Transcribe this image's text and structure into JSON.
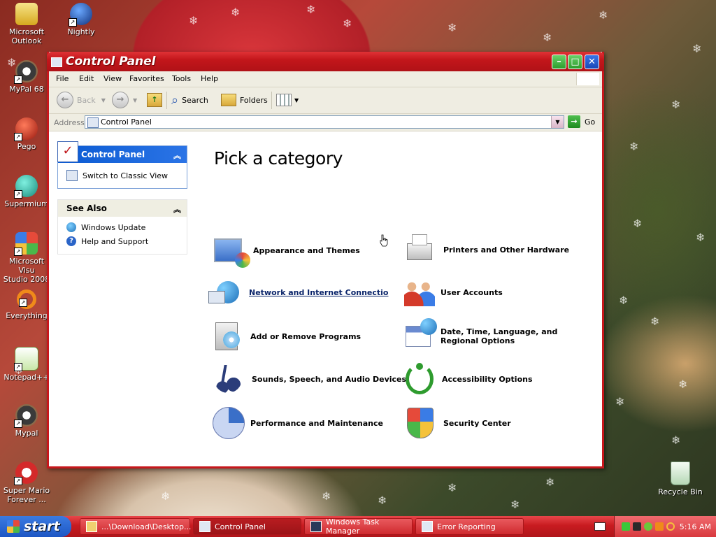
{
  "desktop": {
    "icons": [
      {
        "label": "Microsoft\nOutlook"
      },
      {
        "label": "Nightly"
      },
      {
        "label": "MyPal 68"
      },
      {
        "label": "Pego"
      },
      {
        "label": "Supermium"
      },
      {
        "label": "Microsoft Visu\nStudio 2008"
      },
      {
        "label": "Everything"
      },
      {
        "label": "Notepad++"
      },
      {
        "label": "Mypal"
      },
      {
        "label": "Super Mario\nForever ..."
      },
      {
        "label": "Recycle Bin"
      }
    ]
  },
  "window": {
    "title": "Control Panel",
    "menu": [
      "File",
      "Edit",
      "View",
      "Favorites",
      "Tools",
      "Help"
    ],
    "toolbar": {
      "back": "Back",
      "search": "Search",
      "folders": "Folders"
    },
    "address": {
      "label": "Address",
      "value": "Control Panel",
      "go": "Go"
    },
    "task_panel": {
      "header": "Control Panel",
      "switch_view": "Switch to Classic View"
    },
    "see_also": {
      "header": "See Also",
      "items": [
        "Windows Update",
        "Help and Support"
      ]
    },
    "heading": "Pick a category",
    "categories": {
      "left": [
        {
          "label": "Appearance and Themes",
          "icon": "appearance-themes-icon"
        },
        {
          "label": "Network and Internet Connectio",
          "icon": "network-icon"
        },
        {
          "label": "Add or Remove Programs",
          "icon": "add-remove-programs-icon"
        },
        {
          "label": "Sounds, Speech, and Audio Devices",
          "icon": "sounds-icon"
        },
        {
          "label": "Performance and Maintenance",
          "icon": "performance-icon"
        }
      ],
      "right": [
        {
          "label": "Printers and Other Hardware",
          "icon": "printer-icon"
        },
        {
          "label": "User Accounts",
          "icon": "user-accounts-icon"
        },
        {
          "label_line1": "Date, Time, Language, and",
          "label_line2": "Regional Options",
          "icon": "date-time-icon"
        },
        {
          "label": "Accessibility Options",
          "icon": "accessibility-icon"
        },
        {
          "label": "Security Center",
          "icon": "security-shield-icon"
        }
      ]
    }
  },
  "taskbar": {
    "start": "start",
    "tasks": [
      {
        "label": "...\\Download\\Desktop..."
      },
      {
        "label": "Control Panel"
      },
      {
        "label": "Windows Task Manager"
      },
      {
        "label": "Error Reporting"
      }
    ],
    "clock": "5:16 AM"
  },
  "colors": {
    "title_red": "#c3161b",
    "link_blue": "#0a246a",
    "panel_blue": "#0a5ad2"
  }
}
